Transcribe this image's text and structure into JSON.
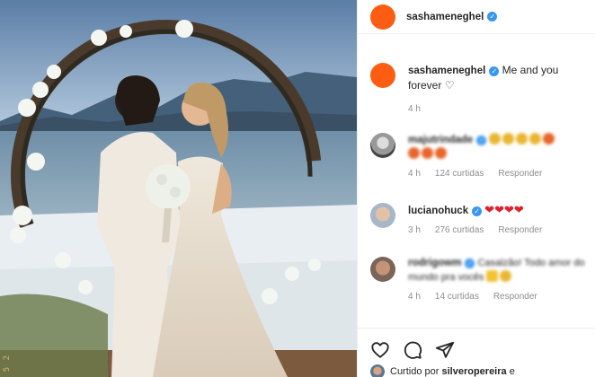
{
  "post": {
    "author": "sashameneghel",
    "caption_author": "sashameneghel",
    "caption_text": "Me and you forever",
    "caption_heart": "♡",
    "time": "4 h",
    "photo_stamp": "5 2"
  },
  "comments": [
    {
      "author": "majutrindade",
      "time": "4 h",
      "likes": "124 curtidas",
      "reply": "Responder",
      "avatar": "grey"
    },
    {
      "author": "lucianohuck",
      "text": "❤❤❤❤",
      "time": "3 h",
      "likes": "276 curtidas",
      "reply": "Responder",
      "avatar": "luciano"
    },
    {
      "author": "rodrigowm",
      "text": "Casalzão! Todo amor do mundo pra vocês",
      "time": "4 h",
      "likes": "14 curtidas",
      "reply": "Responder",
      "avatar": "rodrigo"
    }
  ],
  "likes_line": {
    "prefix": "Curtido por",
    "user": "silveropereira",
    "suffix": "e"
  },
  "icons": {
    "like": "heart-icon",
    "comment": "comment-icon",
    "share": "share-icon",
    "verified": "verified-badge-icon"
  },
  "colors": {
    "avatar_orange": "#fd5d12",
    "verified_blue": "#3897f0",
    "muted_text": "#8e8e8e",
    "heart_red": "#e0202a"
  }
}
